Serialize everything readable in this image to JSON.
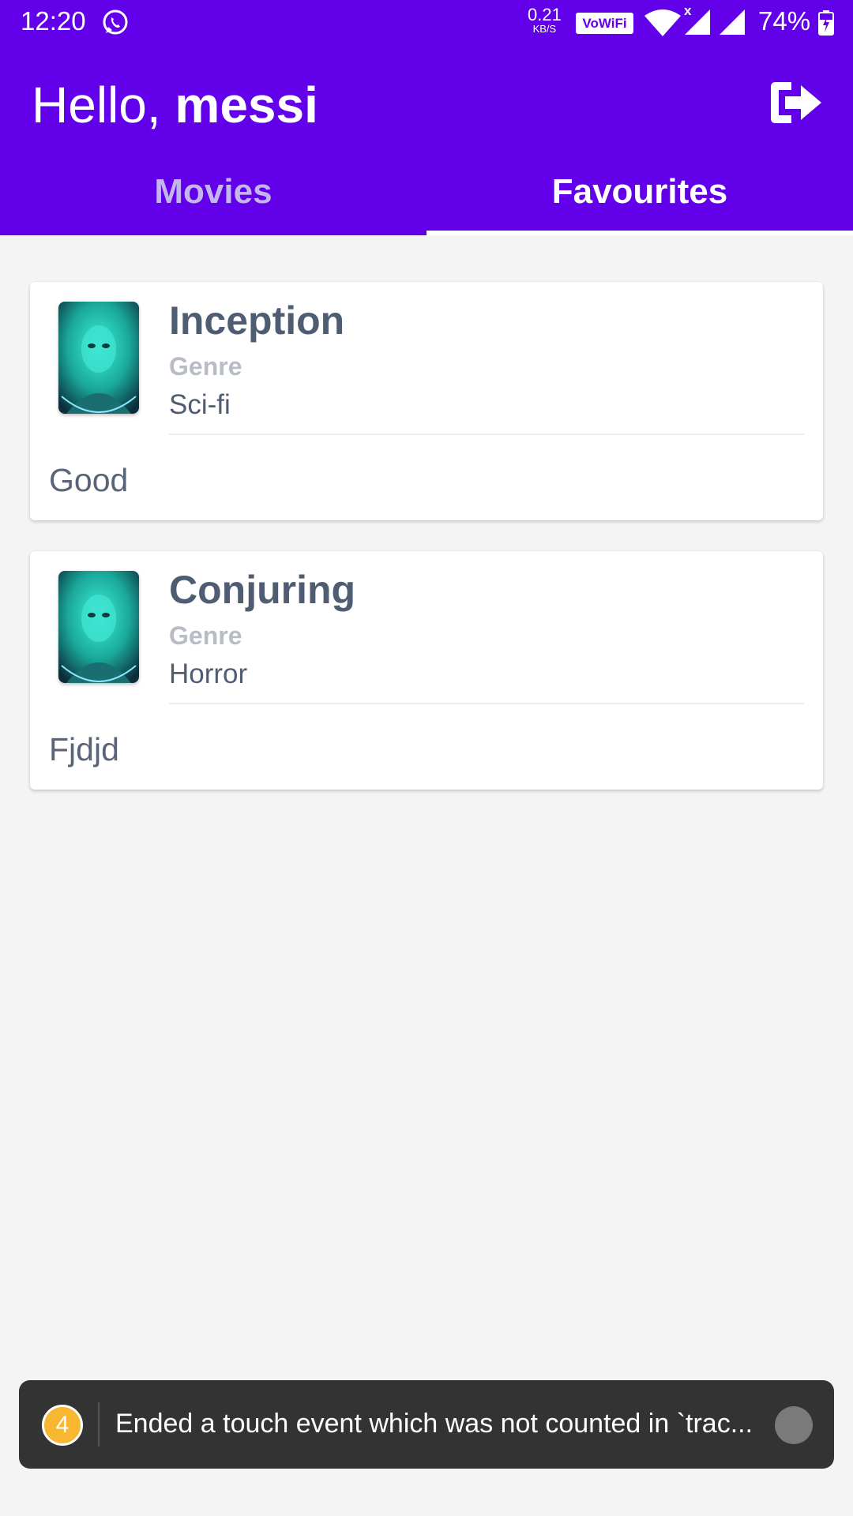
{
  "status_bar": {
    "time": "12:20",
    "net_speed_value": "0.21",
    "net_speed_unit": "KB/S",
    "vowifi_label": "VoWiFi",
    "signal_x": "x",
    "battery_percent": "74%"
  },
  "header": {
    "greeting_prefix": "Hello, ",
    "user_name": "messi",
    "background_color": "#6200ea"
  },
  "tabs": [
    {
      "label": "Movies",
      "selected": false
    },
    {
      "label": "Favourites",
      "selected": true
    }
  ],
  "favourites": [
    {
      "title": "Inception",
      "genre_label": "Genre",
      "genre": "Sci-fi",
      "review": "Good"
    },
    {
      "title": "Conjuring",
      "genre_label": "Genre",
      "genre": "Horror",
      "review": "Fjdjd"
    }
  ],
  "toast": {
    "badge": "4",
    "message": "Ended a touch event which was not counted in `trac..."
  }
}
